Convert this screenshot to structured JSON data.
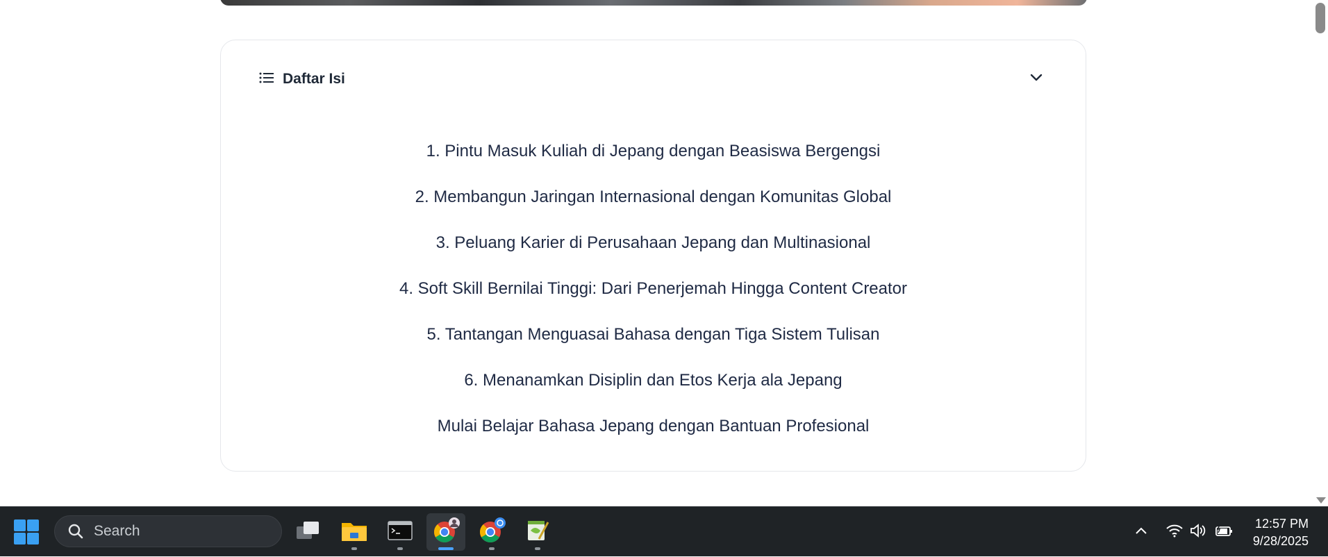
{
  "toc": {
    "title": "Daftar Isi",
    "icon": "list-icon",
    "toggle_icon": "chevron-down-icon",
    "items": [
      {
        "label": "1. Pintu Masuk Kuliah di Jepang dengan Beasiswa Bergengsi"
      },
      {
        "label": "2. Membangun Jaringan Internasional dengan Komunitas Global"
      },
      {
        "label": "3. Peluang Karier di Perusahaan Jepang dan Multinasional"
      },
      {
        "label": "4. Soft Skill Bernilai Tinggi: Dari Penerjemah Hingga Content Creator"
      },
      {
        "label": "5. Tantangan Menguasai Bahasa dengan Tiga Sistem Tulisan"
      },
      {
        "label": "6. Menanamkan Disiplin dan Etos Kerja ala Jepang"
      },
      {
        "label": "Mulai Belajar Bahasa Jepang dengan Bantuan Profesional"
      }
    ]
  },
  "taskbar": {
    "search_placeholder": "Search",
    "apps": [
      {
        "name": "task-view",
        "icon": "task-view-icon"
      },
      {
        "name": "file-explorer",
        "icon": "folder-icon"
      },
      {
        "name": "terminal",
        "icon": "terminal-icon"
      },
      {
        "name": "chrome-profile",
        "icon": "chrome-icon",
        "active": true
      },
      {
        "name": "chrome-second-profile",
        "icon": "chrome-icon"
      },
      {
        "name": "notepad-plus",
        "icon": "notepad-icon"
      }
    ],
    "tray_icons": [
      "chevron-up-icon",
      "wifi-icon",
      "volume-icon",
      "battery-icon"
    ],
    "time": "12:57 PM",
    "date": "9/28/2025"
  },
  "colors": {
    "accent": "#4aa3ff",
    "text": "#1f2a44",
    "taskbar": "#1f2326"
  }
}
